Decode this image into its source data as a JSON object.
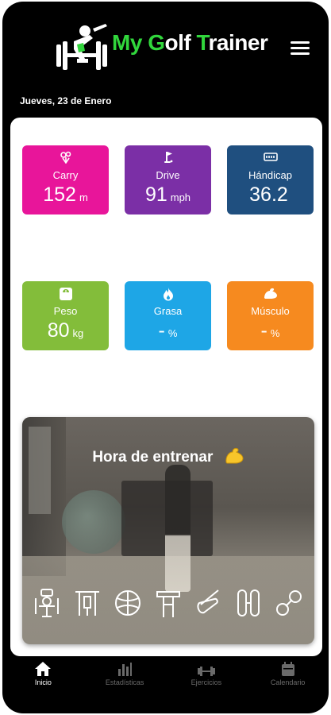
{
  "header": {
    "brand_part1": "My",
    "brand_part2_letter": "G",
    "brand_part2_rest": "olf",
    "brand_part3_letter": "T",
    "brand_part3_rest": "rainer",
    "date": "Jueves, 23 de Enero"
  },
  "colors": {
    "brand_green": "#31d63c",
    "carry": "#e8159a",
    "drive": "#7b2fa6",
    "handicap": "#1f4f7f",
    "peso": "#83bd3a",
    "grasa": "#1ea6e6",
    "musculo": "#f68a1f"
  },
  "stats": {
    "carry": {
      "label": "Carry",
      "value": "152",
      "unit": "m",
      "icon": "golf-bag-icon"
    },
    "drive": {
      "label": "Drive",
      "value": "91",
      "unit": "mph",
      "icon": "golf-flag-icon"
    },
    "handicap": {
      "label": "Hándicap",
      "value": "36.2",
      "unit": "",
      "icon": "scorecard-icon"
    },
    "peso": {
      "label": "Peso",
      "value": "80",
      "unit": "kg",
      "icon": "scale-icon"
    },
    "grasa": {
      "label": "Grasa",
      "value": "-",
      "unit": "%",
      "icon": "flame-icon"
    },
    "musculo": {
      "label": "Músculo",
      "value": "-",
      "unit": "%",
      "icon": "flexed-arm-icon"
    }
  },
  "training": {
    "title": "Hora de entrenar",
    "equipment_icons": [
      "machine-icon",
      "pullup-bar-icon",
      "medicine-ball-icon",
      "kettlebell-station-icon",
      "trx-strap-icon",
      "resistance-band-icon",
      "dumbbell-icon"
    ]
  },
  "nav": [
    {
      "label": "Inicio",
      "icon": "home-icon",
      "active": true
    },
    {
      "label": "Estadísticas",
      "icon": "bar-chart-icon",
      "active": false
    },
    {
      "label": "Ejercicios",
      "icon": "dumbbell-icon",
      "active": false
    },
    {
      "label": "Calendario",
      "icon": "calendar-icon",
      "active": false
    }
  ]
}
